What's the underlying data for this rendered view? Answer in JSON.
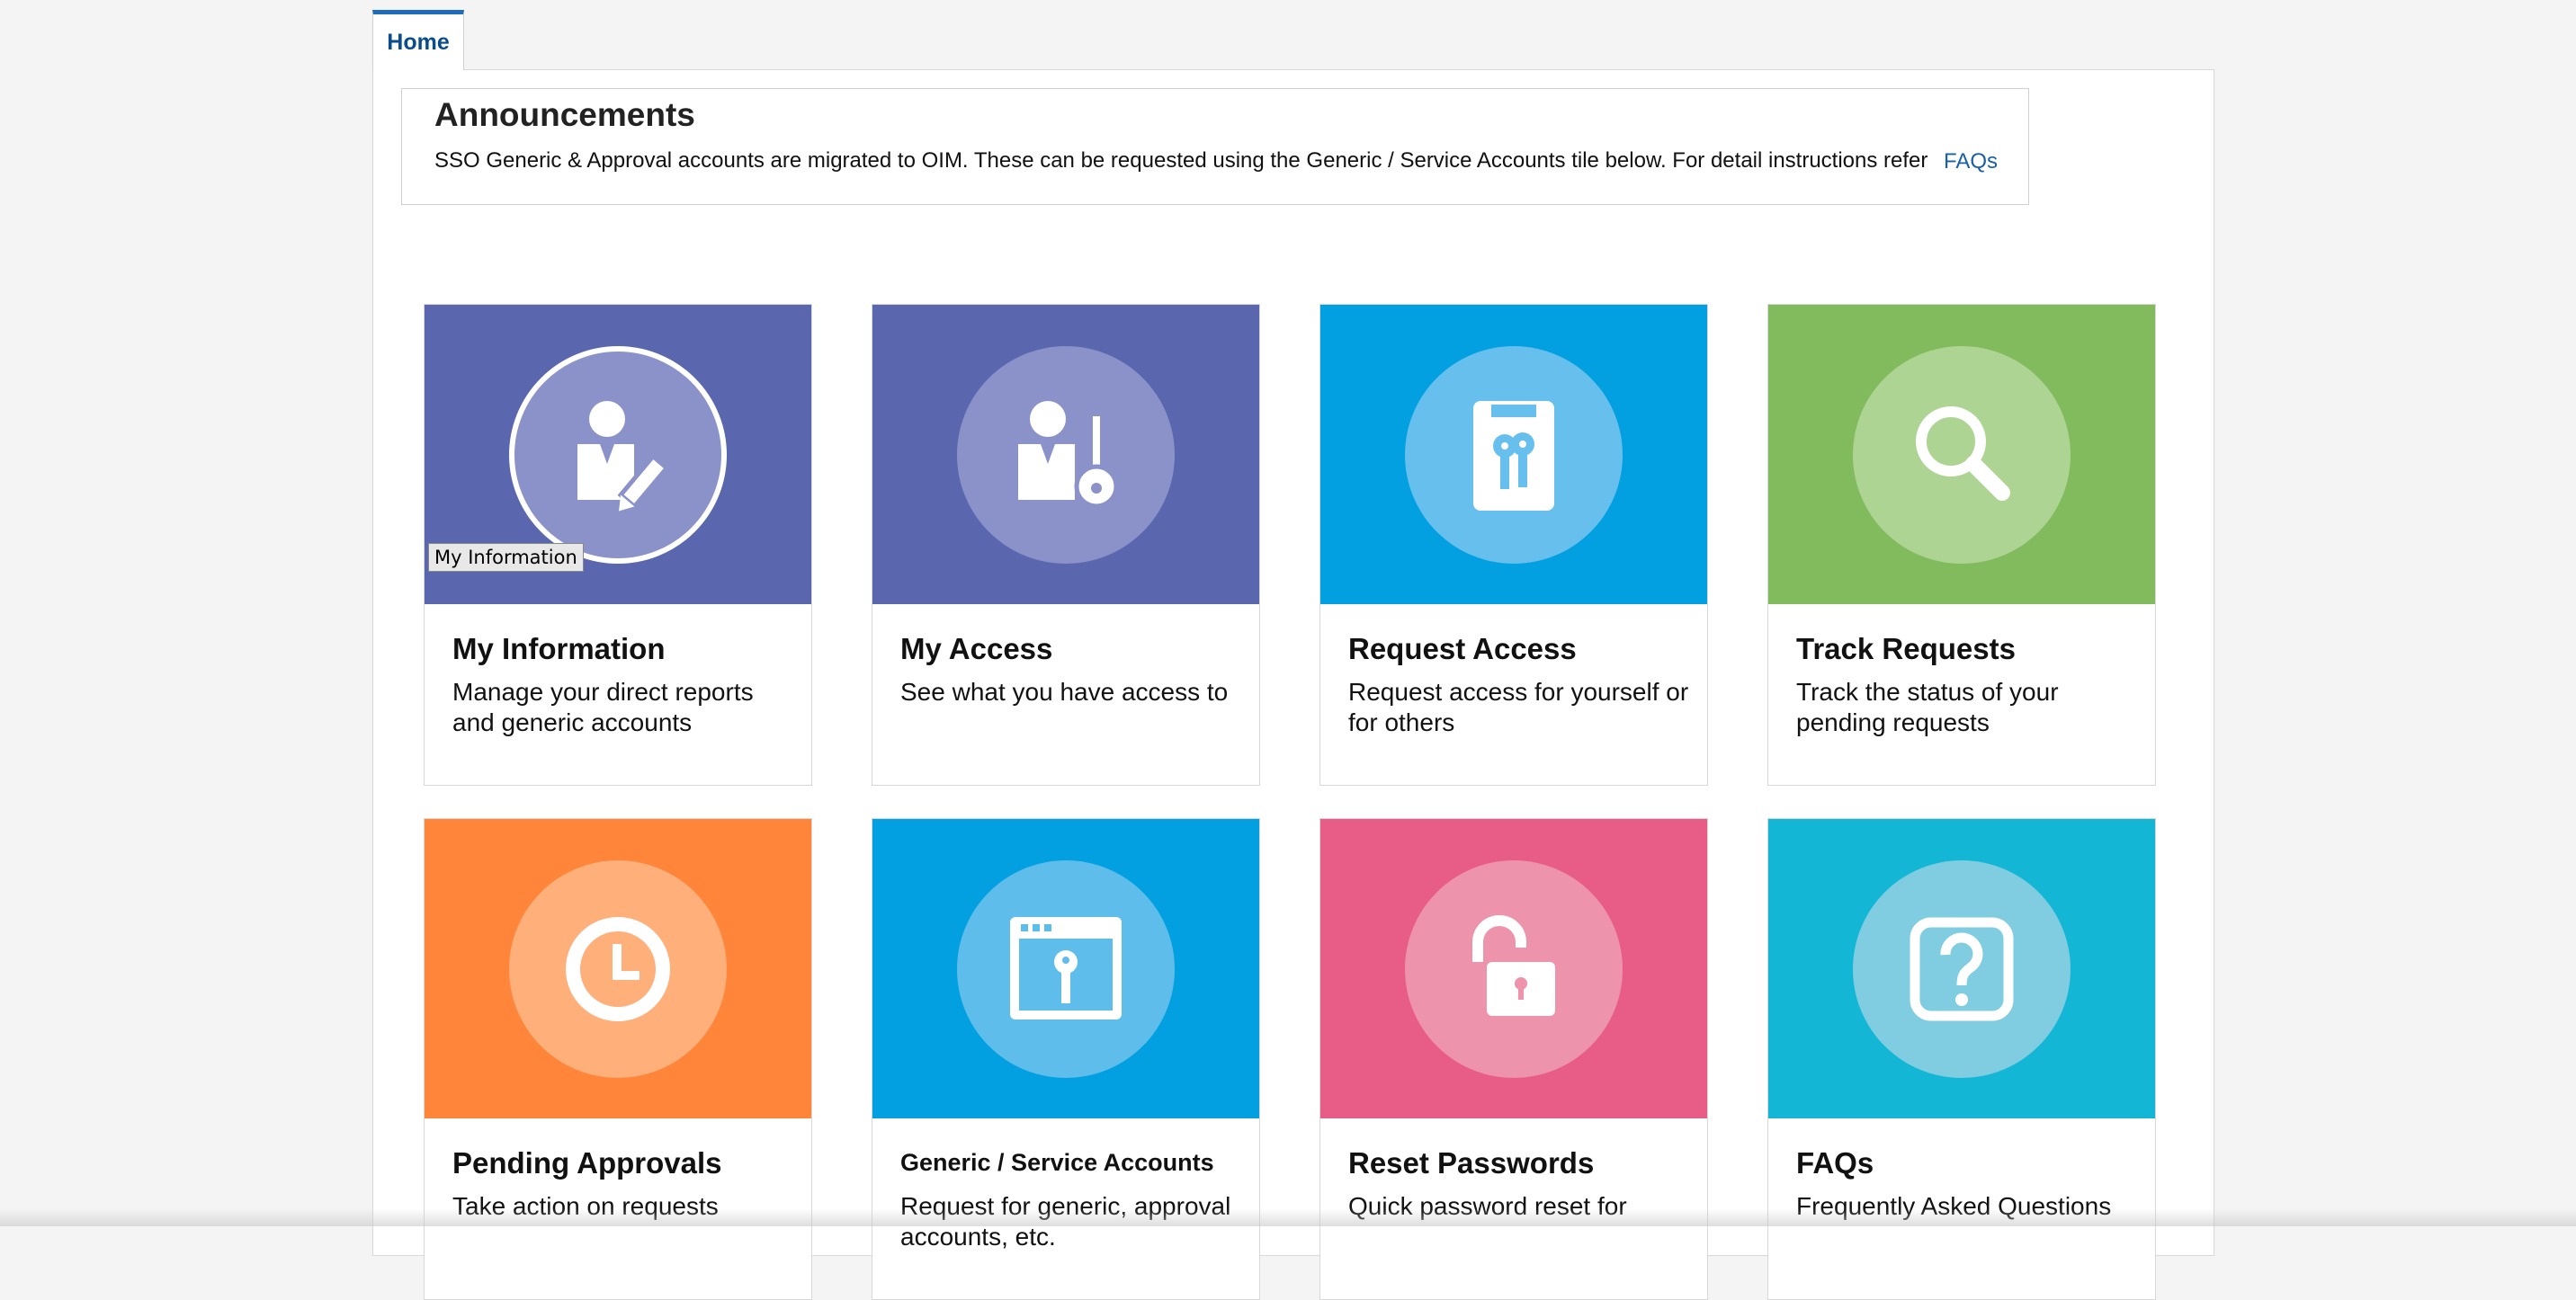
{
  "tabs": [
    {
      "label": "Home",
      "active": true
    }
  ],
  "announcements": {
    "title": "Announcements",
    "text": "SSO Generic & Approval accounts are migrated to OIM. These can be requested using the Generic / Service Accounts tile below. For detail instructions refer",
    "link_label": "FAQs"
  },
  "tooltip": "My Information",
  "tiles": [
    {
      "title": "My Information",
      "description": "Manage your direct reports and generic accounts",
      "color": "#5a67ae",
      "icon": "user-edit-icon"
    },
    {
      "title": "My Access",
      "description": "See what you have access to",
      "color": "#5a67ae",
      "icon": "user-key-icon"
    },
    {
      "title": "Request Access",
      "description": "Request access for yourself or for others",
      "color": "#02a0e0",
      "icon": "clipboard-keys-icon"
    },
    {
      "title": "Track Requests",
      "description": "Track the status of your pending requests",
      "color": "#82bb5e",
      "icon": "search-icon"
    },
    {
      "title": "Pending Approvals",
      "description": "Take action on requests",
      "color": "#fe853a",
      "icon": "clock-icon"
    },
    {
      "title": "Generic / Service Accounts",
      "description": "Request for generic, approval accounts, etc.",
      "color": "#02a0e0",
      "icon": "window-key-icon"
    },
    {
      "title": "Reset Passwords",
      "description": "Quick password reset for",
      "color": "#e85d87",
      "icon": "unlock-icon"
    },
    {
      "title": "FAQs",
      "description": "Frequently Asked Questions",
      "color": "#13b6d5",
      "icon": "question-icon"
    }
  ]
}
